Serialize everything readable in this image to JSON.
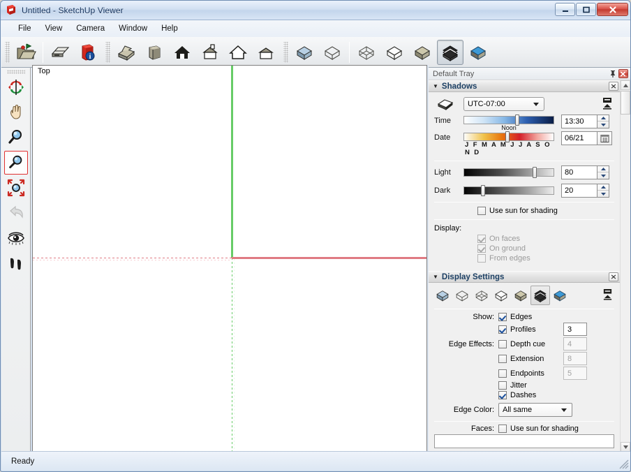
{
  "window": {
    "title": "Untitled - SketchUp Viewer",
    "app_icon": "sketchup-logo-icon",
    "controls": {
      "minimize": "minimize-icon",
      "maximize": "maximize-icon",
      "close": "close-icon"
    }
  },
  "menubar": {
    "items": [
      {
        "label": "File"
      },
      {
        "label": "View"
      },
      {
        "label": "Camera"
      },
      {
        "label": "Window"
      },
      {
        "label": "Help"
      }
    ]
  },
  "toolbar": {
    "groups": [
      {
        "buttons": [
          {
            "name": "open-icon",
            "active": false
          }
        ]
      },
      {
        "buttons": [
          {
            "name": "print-icon",
            "active": false
          },
          {
            "name": "model-info-icon",
            "active": false
          }
        ]
      },
      {
        "buttons": [
          {
            "name": "iso-view-icon",
            "active": false
          },
          {
            "name": "top-view-icon",
            "active": false
          },
          {
            "name": "front-view-icon",
            "active": false
          },
          {
            "name": "right-view-icon",
            "active": false
          },
          {
            "name": "back-view-icon",
            "active": false
          },
          {
            "name": "left-view-icon",
            "active": false
          }
        ]
      },
      {
        "buttons": [
          {
            "name": "style-shaded-texture-icon",
            "active": false
          },
          {
            "name": "style-wireframe-icon",
            "active": false
          }
        ]
      },
      {
        "buttons": [
          {
            "name": "style-xray-icon",
            "active": false
          },
          {
            "name": "style-hidden-line-icon",
            "active": false
          },
          {
            "name": "style-shaded-icon",
            "active": false
          },
          {
            "name": "style-monochrome-icon",
            "active": true
          },
          {
            "name": "style-shaded-with-textures-icon",
            "active": false
          }
        ]
      }
    ]
  },
  "left_toolbar": {
    "tools": [
      {
        "name": "orbit-tool",
        "state": "normal"
      },
      {
        "name": "pan-tool",
        "state": "normal"
      },
      {
        "name": "zoom-tool",
        "state": "normal"
      },
      {
        "name": "zoom-window-tool",
        "state": "selected"
      },
      {
        "name": "zoom-extents-tool",
        "state": "normal"
      },
      {
        "name": "previous-view-tool",
        "state": "disabled"
      },
      {
        "name": "look-around-tool",
        "state": "normal"
      },
      {
        "name": "walk-tool",
        "state": "normal"
      }
    ]
  },
  "viewport": {
    "label": "Top",
    "axes": {
      "green_axis_color": "#67cc67",
      "red_axis_color": "#e07b83"
    }
  },
  "tray": {
    "title": "Default Tray",
    "pin_icon": "pin-icon",
    "close_icon": "close-icon",
    "scrollbar": {
      "up_arrow": "chevron-up-icon",
      "down_arrow": "chevron-down-icon"
    }
  },
  "shadows": {
    "title": "Shadows",
    "collapse_icon": "triangle-down-icon",
    "close_icon": "close-icon",
    "shadow_toggle_icon": "shadow-toggle-icon",
    "display_shadows_icon": "display-shadows-icon",
    "timezone": {
      "value": "UTC-07:00",
      "dropdown_icon": "chevron-down-icon"
    },
    "time": {
      "label": "Time",
      "value": "13:30",
      "slider_position_pct": 60,
      "caption": "Noon"
    },
    "date": {
      "label": "Date",
      "value": "06/21",
      "slider_position_pct": 48,
      "months_scale": "J F M A M J  J A S O N D",
      "calendar_icon": "calendar-icon"
    },
    "light": {
      "label": "Light",
      "value": "80",
      "slider_position_pct": 80
    },
    "dark": {
      "label": "Dark",
      "value": "20",
      "slider_position_pct": 20
    },
    "use_sun_for_shading": {
      "label": "Use sun for shading",
      "checked": false,
      "disabled": false
    },
    "display_label": "Display:",
    "display_options": [
      {
        "label": "On faces",
        "checked": true,
        "disabled": true
      },
      {
        "label": "On ground",
        "checked": true,
        "disabled": true
      },
      {
        "label": "From edges",
        "checked": false,
        "disabled": true
      }
    ]
  },
  "display_settings": {
    "title": "Display Settings",
    "collapse_icon": "triangle-down-icon",
    "close_icon": "close-icon",
    "style_buttons": [
      {
        "name": "style-shaded-texture-icon",
        "active": false
      },
      {
        "name": "style-wireframe-icon",
        "active": false
      },
      {
        "name": "style-xray-icon",
        "active": false
      },
      {
        "name": "style-hidden-line-icon",
        "active": false
      },
      {
        "name": "style-shaded-icon",
        "active": false
      },
      {
        "name": "style-monochrome-icon",
        "active": true
      },
      {
        "name": "style-shaded-with-textures-icon",
        "active": false
      }
    ],
    "pin_icon": "display-settings-pin-icon",
    "show_label": "Show:",
    "edge_effects_label": "Edge Effects:",
    "edge_color_label": "Edge Color:",
    "faces_label": "Faces:",
    "options": [
      {
        "label": "Edges",
        "checked": true,
        "disabled": false,
        "number": null,
        "num_disabled": false
      },
      {
        "label": "Profiles",
        "checked": true,
        "disabled": false,
        "number": "3",
        "num_disabled": false
      },
      {
        "label": "Depth cue",
        "checked": false,
        "disabled": false,
        "number": "4",
        "num_disabled": true
      },
      {
        "label": "Extension",
        "checked": false,
        "disabled": false,
        "number": "8",
        "num_disabled": true
      },
      {
        "label": "Endpoints",
        "checked": false,
        "disabled": false,
        "number": "5",
        "num_disabled": true
      },
      {
        "label": "Jitter",
        "checked": false,
        "disabled": false,
        "number": null,
        "num_disabled": false
      },
      {
        "label": "Dashes",
        "checked": true,
        "disabled": false,
        "number": null,
        "num_disabled": false
      }
    ],
    "edge_color": {
      "value": "All same",
      "dropdown_icon": "chevron-down-icon"
    },
    "faces_option": {
      "label": "Use sun for shading",
      "checked": false
    }
  },
  "statusbar": {
    "text": "Ready",
    "resize_grip": "resize-grip-icon"
  }
}
